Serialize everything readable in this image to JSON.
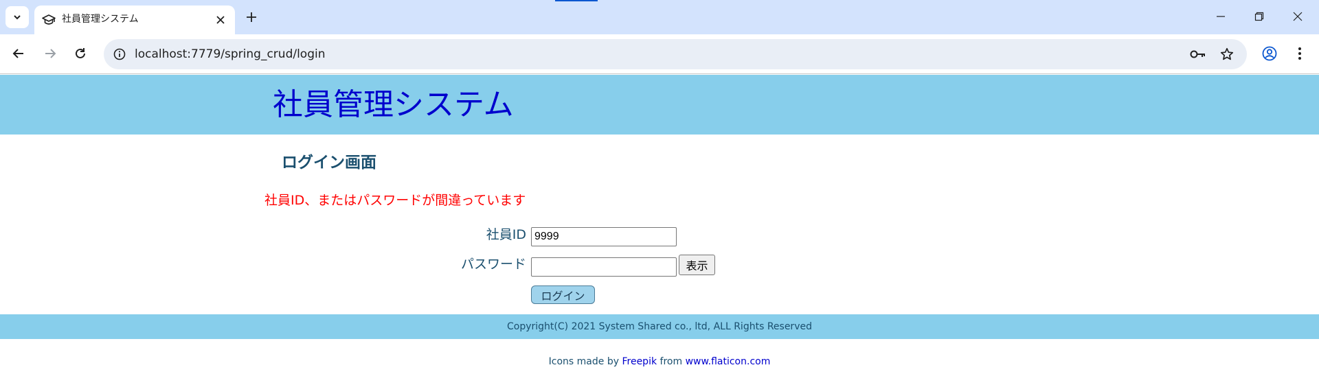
{
  "browser": {
    "tab_title": "社員管理システム",
    "url": "localhost:7779/spring_crud/login"
  },
  "header": {
    "system_title": "社員管理システム"
  },
  "login": {
    "screen_title": "ログイン画面",
    "error_message": "社員ID、またはパスワードが間違っています",
    "employee_id_label": "社員ID",
    "employee_id_value": "9999",
    "password_label": "パスワード",
    "password_value": "",
    "show_button_label": "表示",
    "login_button_label": "ログイン"
  },
  "footer": {
    "copyright": "Copyright(C) 2021 System Shared co., ltd, ALL Rights Reserved",
    "credits_prefix": "Icons made by",
    "credits_author": "Freepik",
    "credits_middle": "from",
    "credits_site": "www.flaticon.com"
  },
  "colors": {
    "header_bg": "#87ceeb",
    "title_blue": "#0000cd",
    "error_red": "#ff0000",
    "tabbar_bg": "#d3e3fd"
  },
  "icons": {
    "tab_favicon": "graduation-cap-icon",
    "site_info": "info-circle-icon",
    "password_manager": "key-icon",
    "bookmark": "star-icon",
    "profile": "account-circle-icon"
  }
}
